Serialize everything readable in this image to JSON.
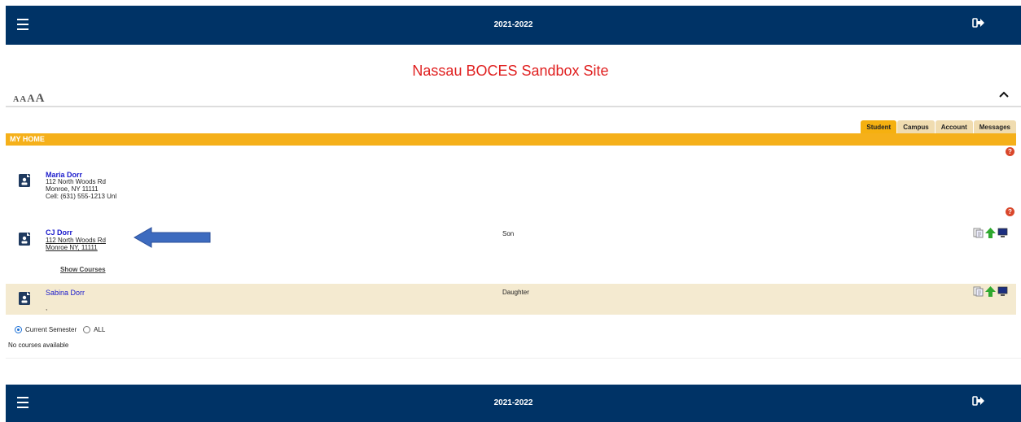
{
  "topbar": {
    "year": "2021-2022"
  },
  "site": {
    "title": "Nassau BOCES Sandbox Site"
  },
  "font_sizes": [
    "A",
    "A",
    "A",
    "A"
  ],
  "tabs": [
    {
      "label": "Student",
      "active": true
    },
    {
      "label": "Campus",
      "active": false
    },
    {
      "label": "Account",
      "active": false
    },
    {
      "label": "Messages",
      "active": false
    }
  ],
  "home": {
    "title": "MY HOME"
  },
  "parent": {
    "name": "Maria Dorr",
    "address1": "112 North Woods Rd",
    "address2": "Monroe, NY 11111",
    "phone": "Cell: (631) 555-1213 Unl"
  },
  "students": [
    {
      "name": "CJ Dorr",
      "address1": "112 North Woods Rd",
      "address2": "Monroe NY, 11111",
      "relation": "Son",
      "show_courses": "Show Courses"
    },
    {
      "name": "Sabina Dorr",
      "address1": ",",
      "relation": "Daughter"
    }
  ],
  "semester": {
    "current_label": "Current Semester",
    "all_label": "ALL",
    "selected": "Current Semester"
  },
  "courses": {
    "empty_text": "No courses available"
  },
  "help_label": "?",
  "colors": {
    "navy": "#003366",
    "gold": "#f5b01a",
    "title_red": "#e02020",
    "link_blue": "#1a1acc",
    "annotation_arrow": "#3d6bbf"
  },
  "icons": [
    "menu-icon",
    "sign-out-icon",
    "chevron-up-icon",
    "help-icon",
    "person-card-icon",
    "documents-icon",
    "up-arrow-icon",
    "monitor-icon"
  ]
}
